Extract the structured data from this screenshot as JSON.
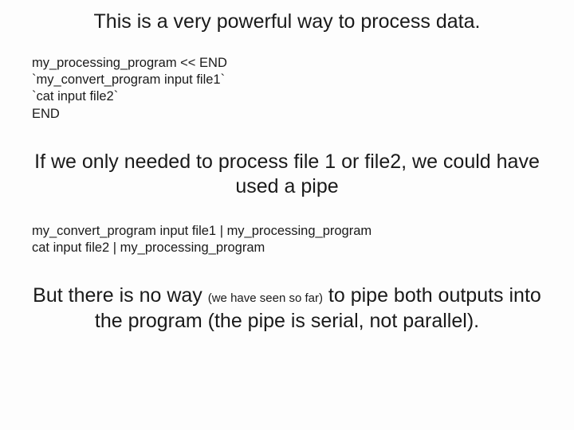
{
  "heading1": "This is a very powerful way to process data.",
  "code1": "my_processing_program << END\n`my_convert_program input file1`\n`cat input file2`\nEND",
  "heading2": "If we only needed to process file 1 or file2, we could have used a pipe",
  "code2": "my_convert_program input file1 | my_processing_program\ncat input file2 | my_processing_program",
  "heading3_a": "But there is no way ",
  "heading3_note": "(we have seen so far)",
  "heading3_b": " to pipe both outputs into the program (the pipe is serial, not parallel)."
}
